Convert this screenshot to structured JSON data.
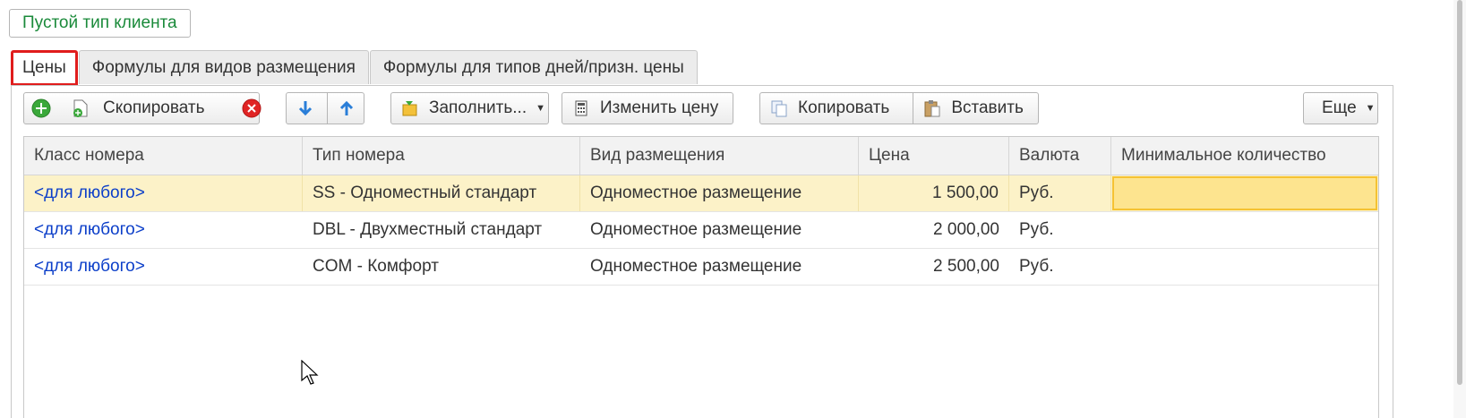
{
  "top_button": {
    "label": "Пустой тип клиента"
  },
  "tabs": [
    {
      "label": "Цены",
      "active": true
    },
    {
      "label": "Формулы для видов размещения",
      "active": false
    },
    {
      "label": "Формулы для типов дней/призн. цены",
      "active": false
    }
  ],
  "toolbar": {
    "copy_row_label": "Скопировать",
    "fill_label": "Заполнить...",
    "change_price_label": "Изменить цену",
    "copy_label": "Копировать",
    "paste_label": "Вставить",
    "more_label": "Еще"
  },
  "table": {
    "columns": [
      "Класс номера",
      "Тип номера",
      "Вид размещения",
      "Цена",
      "Валюта",
      "Минимальное количество"
    ],
    "rows": [
      {
        "class": "<для любого>",
        "type": "SS - Одноместный стандарт",
        "placement": "Одноместное размещение",
        "price": "1 500,00",
        "currency": "Руб.",
        "min_qty": "",
        "selected": true
      },
      {
        "class": "<для любого>",
        "type": "DBL - Двухместный стандарт",
        "placement": "Одноместное размещение",
        "price": "2 000,00",
        "currency": "Руб.",
        "min_qty": ""
      },
      {
        "class": "<для любого>",
        "type": "COM - Комфорт",
        "placement": "Одноместное размещение",
        "price": "2 500,00",
        "currency": "Руб.",
        "min_qty": ""
      }
    ]
  },
  "colors": {
    "accent_green": "#1a8a3a",
    "link_blue": "#0b3ec9",
    "selected_row": "#fcf2c8",
    "focus_cell": "#fde48f",
    "tab_highlight": "#e01c1c"
  }
}
